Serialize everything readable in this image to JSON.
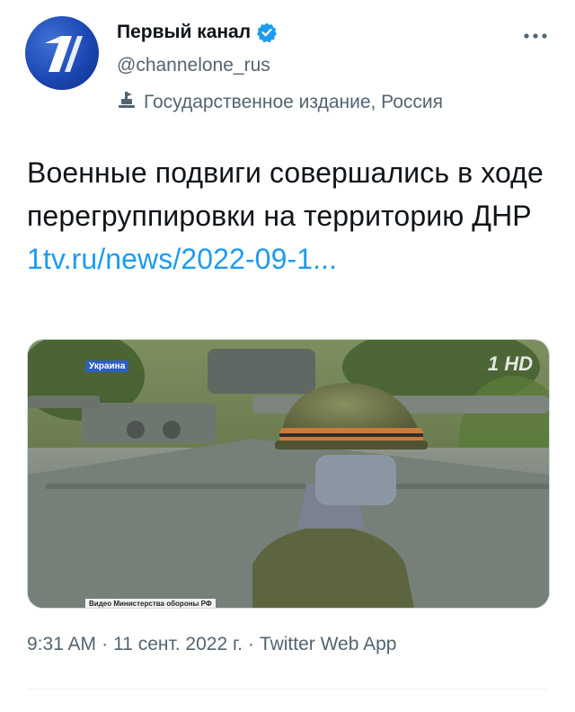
{
  "author": {
    "display_name": "Первый канал",
    "handle": "@channelone_rus",
    "label": "Государственное издание, Россия",
    "avatar_icon": "channel-one-logo",
    "verified": true
  },
  "tweet": {
    "text": "Военные подвиги совершались в ходе перегруппировки на территорию ДНР",
    "link": "1tv.ru/news/2022-09-1..."
  },
  "media": {
    "region_badge": "Украина",
    "source_caption": "Видео Министерства обороны РФ",
    "watermark": "1 HD"
  },
  "meta": {
    "time": "9:31 AM",
    "date": "11 сент. 2022 г.",
    "source": "Twitter Web App",
    "separator": "·"
  },
  "colors": {
    "link": "#1d9bf0",
    "secondary": "#536471",
    "verified": "#1d9bf0"
  }
}
